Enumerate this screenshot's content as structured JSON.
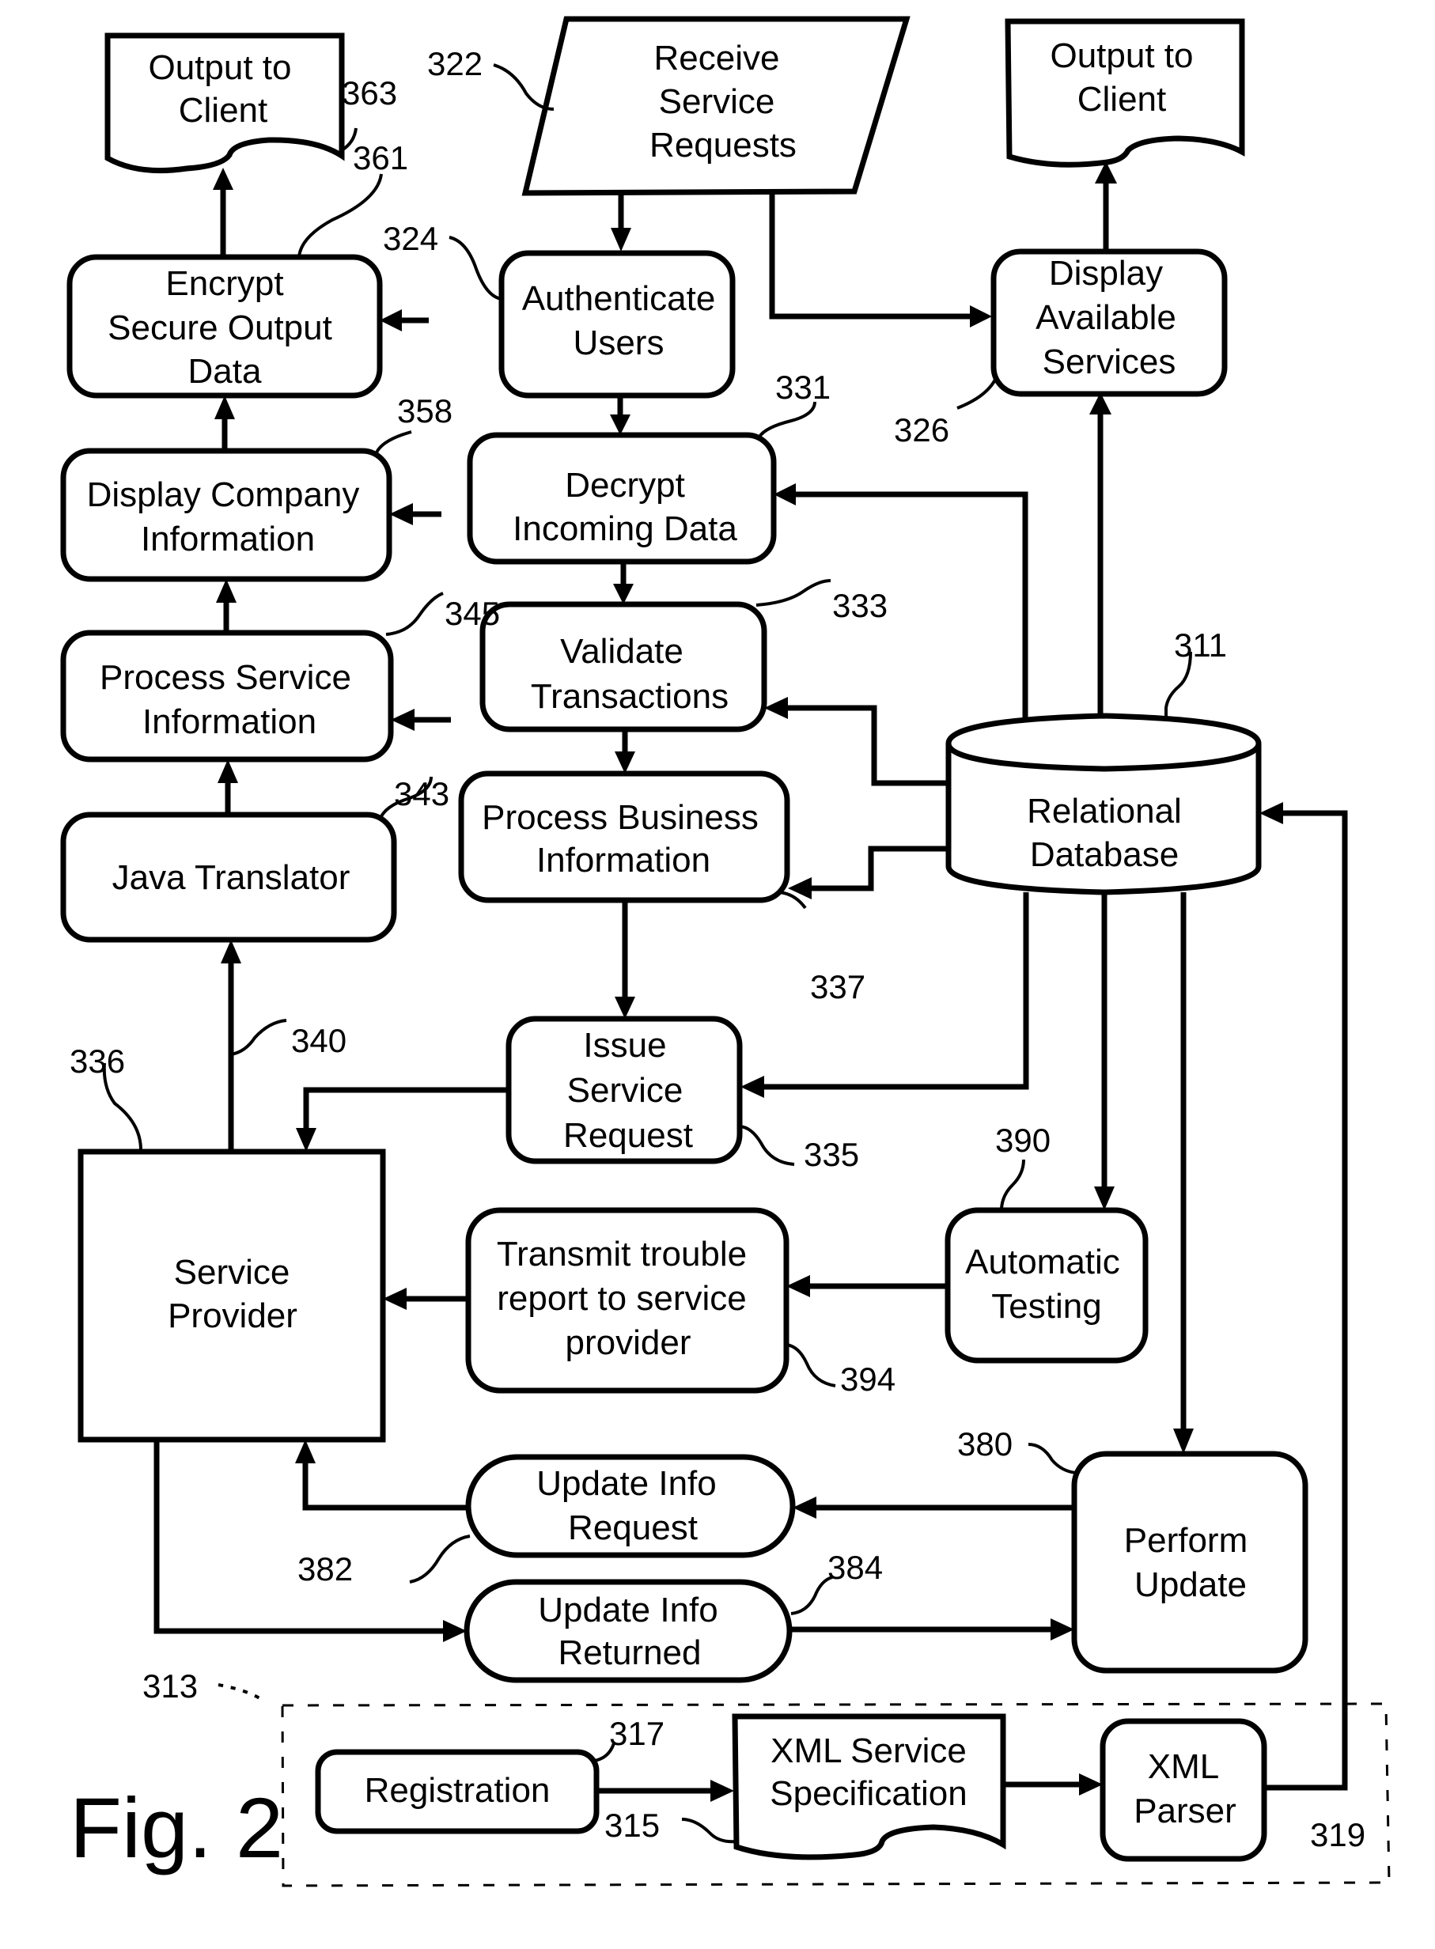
{
  "figure": {
    "title": "Fig. 2"
  },
  "nodes": {
    "output_client_left": {
      "lines": [
        "Output to",
        "Client"
      ],
      "ref": "363"
    },
    "receive_requests": {
      "lines": [
        "Receive",
        "Service",
        "Requests"
      ],
      "ref": "322"
    },
    "output_client_right": {
      "lines": [
        "Output to",
        "Client"
      ]
    },
    "encrypt_output": {
      "lines": [
        "Encrypt",
        "Secure Output",
        "Data"
      ],
      "ref": "361"
    },
    "authenticate_users": {
      "lines": [
        "Authenticate",
        "Users"
      ],
      "ref": "324"
    },
    "display_services": {
      "lines": [
        "Display",
        "Available",
        "Services"
      ],
      "ref": "326"
    },
    "display_company": {
      "lines": [
        "Display Company",
        "Information"
      ],
      "ref": "358"
    },
    "decrypt_incoming": {
      "lines": [
        "Decrypt",
        "Incoming Data"
      ],
      "ref": "331"
    },
    "validate_transactions": {
      "lines": [
        "Validate",
        "Transactions"
      ],
      "ref": "333"
    },
    "process_service": {
      "lines": [
        "Process Service",
        "Information"
      ],
      "ref": "345"
    },
    "relational_database": {
      "lines": [
        "Relational",
        "Database"
      ],
      "ref": "311"
    },
    "java_translator": {
      "lines": [
        "Java Translator"
      ],
      "ref": "343"
    },
    "process_business": {
      "lines": [
        "Process Business",
        "Information"
      ],
      "ref": "337"
    },
    "issue_request": {
      "lines": [
        "Issue",
        "Service",
        "Request"
      ],
      "ref": "335"
    },
    "service_provider": {
      "lines": [
        "Service",
        "Provider"
      ],
      "ref": "336"
    },
    "transmit_trouble": {
      "lines": [
        "Transmit trouble",
        "report to service",
        "provider"
      ],
      "ref": "394"
    },
    "automatic_testing": {
      "lines": [
        "Automatic",
        "Testing"
      ],
      "ref": "390"
    },
    "perform_update": {
      "lines": [
        "Perform",
        "Update"
      ],
      "ref": "380"
    },
    "update_info_request": {
      "lines": [
        "Update Info",
        "Request"
      ],
      "ref": "382"
    },
    "update_info_returned": {
      "lines": [
        "Update Info",
        "Returned"
      ],
      "ref": "384"
    },
    "registration": {
      "lines": [
        "Registration"
      ],
      "ref": "317"
    },
    "xml_spec": {
      "lines": [
        "XML Service",
        "Specification"
      ],
      "ref": "315"
    },
    "xml_parser": {
      "lines": [
        "XML",
        "Parser"
      ],
      "ref": "319"
    }
  },
  "refs": {
    "sp_link": "340",
    "registration_region": "313"
  }
}
